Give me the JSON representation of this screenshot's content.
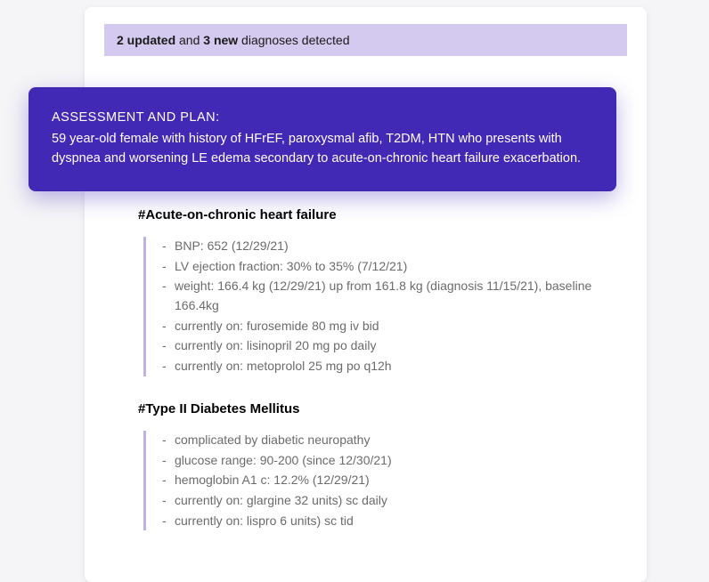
{
  "notice": {
    "updated_count": "2 updated",
    "conjunction": " and ",
    "new_count": "3 new",
    "suffix": " diagnoses detected"
  },
  "assessment": {
    "title": "ASSESSMENT AND PLAN:",
    "body": "59 year-old female with history of HFrEF, paroxysmal afib, T2DM, HTN who presents with dyspnea and worsening LE edema secondary to acute-on-chronic heart failure exacerbation."
  },
  "diagnoses": [
    {
      "title": "#Acute-on-chronic heart failure",
      "items": [
        "BNP: 652 (12/29/21)",
        "LV ejection fraction: 30% to 35% (7/12/21)",
        "weight: 166.4 kg (12/29/21) up from 161.8 kg (diagnosis 11/15/21), baseline 166.4kg",
        "currently on: furosemide 80 mg iv bid",
        "currently on: lisinopril 20 mg po daily",
        "currently on: metoprolol 25 mg po q12h"
      ]
    },
    {
      "title": "#Type II Diabetes Mellitus",
      "items": [
        "complicated by diabetic neuropathy",
        "glucose range: 90-200 (since 12/30/21)",
        "hemoglobin A1 c: 12.2% (12/29/21)",
        "currently on: glargine 32 units) sc daily",
        "currently on: lispro 6 units) sc tid"
      ]
    }
  ]
}
